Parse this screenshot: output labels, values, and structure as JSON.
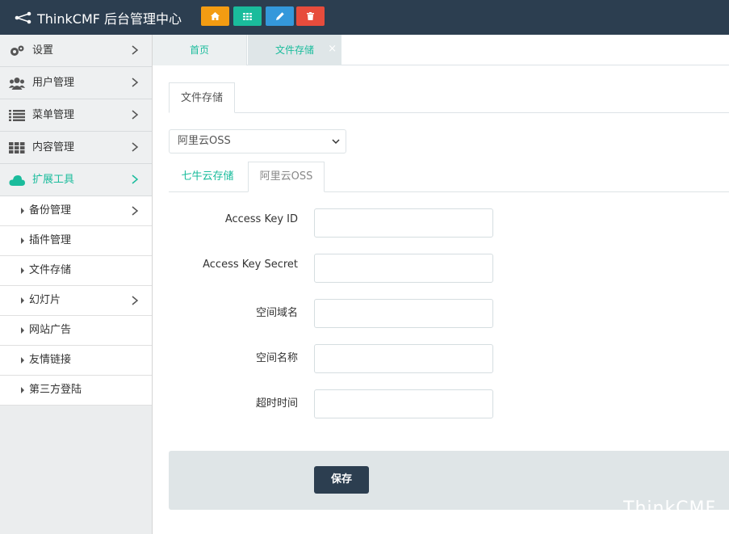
{
  "header": {
    "title": "ThinkCMF 后台管理中心",
    "buttons": [
      {
        "icon": "home-icon",
        "color": "#f39c12"
      },
      {
        "icon": "grid-icon",
        "color": "#1abc9c"
      },
      {
        "icon": "pencil-icon",
        "color": "#3498db"
      },
      {
        "icon": "trash-icon",
        "color": "#e74c3c"
      }
    ],
    "bg_color": "#2c3e50"
  },
  "sidebar": {
    "items": [
      {
        "label": "设置",
        "icon": "gears-icon"
      },
      {
        "label": "用户管理",
        "icon": "users-icon"
      },
      {
        "label": "菜单管理",
        "icon": "list-icon"
      },
      {
        "label": "内容管理",
        "icon": "grid-icon"
      },
      {
        "label": "扩展工具",
        "icon": "cloud-icon",
        "active": true
      }
    ],
    "subitems": [
      {
        "label": "备份管理",
        "has_children": true
      },
      {
        "label": "插件管理"
      },
      {
        "label": "文件存储"
      },
      {
        "label": "幻灯片",
        "has_children": true
      },
      {
        "label": "网站广告"
      },
      {
        "label": "友情链接"
      },
      {
        "label": "第三方登陆"
      }
    ],
    "active_color": "#1abc9c"
  },
  "tabs": {
    "home": "首页",
    "current": "文件存储",
    "close": "×"
  },
  "main": {
    "section_tab": "文件存储",
    "storage_select": "阿里云OSS",
    "provider_tabs": [
      "七牛云存储",
      "阿里云OSS"
    ],
    "active_provider_index": 1,
    "fields": [
      {
        "label": "Access Key ID",
        "value": ""
      },
      {
        "label": "Access Key Secret",
        "value": ""
      },
      {
        "label": "空间域名",
        "value": ""
      },
      {
        "label": "空间名称",
        "value": ""
      },
      {
        "label": "超时时间",
        "value": ""
      }
    ],
    "save_label": "保存"
  },
  "watermark": "ThinkCMF"
}
